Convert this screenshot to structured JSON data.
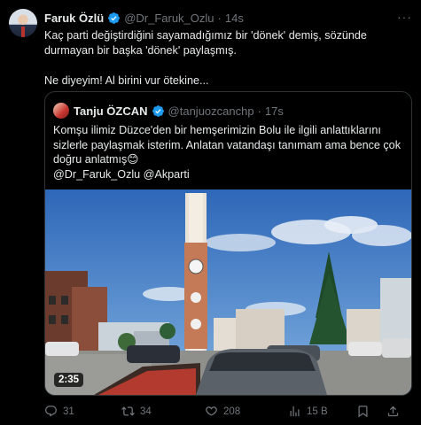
{
  "tweet": {
    "author_name": "Faruk Özlü",
    "handle": "@Dr_Faruk_Ozlu",
    "separator": "·",
    "time": "14s",
    "more_icon": "ellipsis-icon",
    "text": "Kaç parti değiştirdiğini sayamadığımız bir 'dönek' demiş, sözünde durmayan bir başka 'dönek' paylaşmış.\n\nNe diyeyim! Al birini vur ötekine...",
    "verified_color": "#1d9bf0"
  },
  "quote": {
    "author_name": "Tanju ÖZCAN",
    "handle": "@tanjuozcanchp",
    "separator": "·",
    "time": "17s",
    "text": "Komşu ilimiz Düzce'den bir hemşerimizin Bolu ile ilgili anlattıklarını sizlerle paylaşmak isterim. Anlatan vatandaşı tanımam ama bence çok doğru anlatmış😊",
    "mentions": "@Dr_Faruk_Ozlu @Akparti",
    "video_duration": "2:35"
  },
  "actions": {
    "replies": "31",
    "reposts": "34",
    "likes": "208",
    "views": "15 B",
    "icons": [
      "reply-icon",
      "repost-icon",
      "like-icon",
      "views-icon",
      "bookmark-icon",
      "share-icon"
    ]
  }
}
